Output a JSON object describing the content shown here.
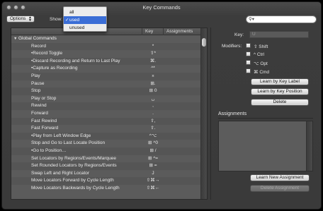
{
  "window": {
    "title": "Key Commands"
  },
  "toolbar": {
    "options_label": "Options",
    "show_label": "Show:"
  },
  "show_menu": {
    "items": [
      "all",
      "used",
      "unused"
    ],
    "selected": "used"
  },
  "search": {
    "placeholder": ""
  },
  "list": {
    "columns": [
      "Key",
      "Assignments"
    ],
    "group": "Global Commands",
    "rows": [
      {
        "label": "Record",
        "key": "*"
      },
      {
        "label": "•Record Toggle",
        "key": "⇧*"
      },
      {
        "label": "•Discard Recording and Return to Last Play",
        "key": "⌘."
      },
      {
        "label": "•Capture as Recording",
        "key": "^*"
      },
      {
        "label": "Play",
        "key": "⌅"
      },
      {
        "label": "Pause",
        "key": "⊞."
      },
      {
        "label": "Stop",
        "key": "⊞ 0"
      },
      {
        "label": "Play or Stop",
        "key": "␣"
      },
      {
        "label": "Rewind",
        "key": ","
      },
      {
        "label": "Forward",
        "key": "."
      },
      {
        "label": "Fast Rewind",
        "key": "⇧,"
      },
      {
        "label": "Fast Forward",
        "key": "⇧."
      },
      {
        "label": "•Play from Left Window Edge",
        "key": "^⌥"
      },
      {
        "label": "Stop and Go to Last Locate Position",
        "key": "⊞ ^0"
      },
      {
        "label": "•Go to Position…",
        "key": "⊞ /"
      },
      {
        "label": "Set Locators by Regions/Events/Marquee",
        "key": "⊞ ^="
      },
      {
        "label": "Set Rounded Locators by Regions/Events",
        "key": "⊞ ="
      },
      {
        "label": "Swap Left and Right Locator",
        "key": "J"
      },
      {
        "label": "Move Locators Forward by Cycle Length",
        "key": "⇧⌘→"
      },
      {
        "label": "Move Locators Backwards by Cycle Length",
        "key": "⇧⌘←"
      }
    ]
  },
  "detail": {
    "key_label": "Key:",
    "key_value": "U",
    "modifiers_label": "Modifiers:",
    "modifiers": [
      {
        "symbol": "⇧",
        "name": "Shift"
      },
      {
        "symbol": "^",
        "name": "Ctrl"
      },
      {
        "symbol": "⌥",
        "name": "Opt"
      },
      {
        "symbol": "⌘",
        "name": "Cmd"
      }
    ],
    "learn_label_button": "Learn by Key Label",
    "learn_position_button": "Learn by Key Position",
    "delete_button": "Delete",
    "assignments_title": "Assignments",
    "learn_new_button": "Learn New Assignment",
    "delete_assignment_button": "Delete Assignment"
  }
}
